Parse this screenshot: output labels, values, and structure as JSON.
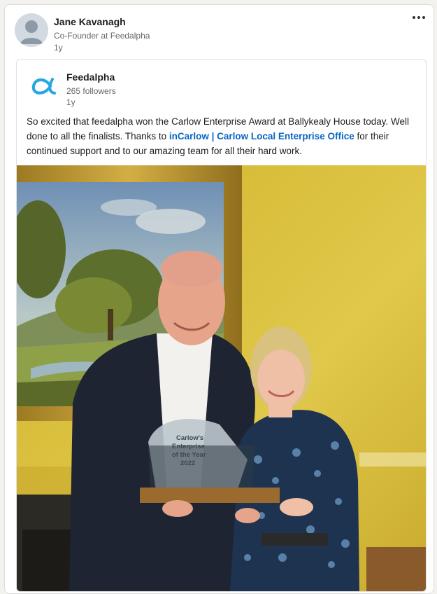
{
  "author": {
    "name": "Jane Kavanagh",
    "headline": "Co-Founder at Feedalpha",
    "time": "1y",
    "more_icon": "more-horizontal-icon"
  },
  "shared_post": {
    "org_name": "Feedalpha",
    "followers": "265 followers",
    "time": "1y",
    "logo_glyph": "α",
    "text_before": "So excited that feedalpha won the Carlow Enterprise Award at Ballykealy House today. Well done to all the finalists. Thanks to ",
    "mention": "inCarlow | Carlow Local Enterprise Office",
    "text_after": "  for their continued support and to our amazing team for all their hard work."
  },
  "photo": {
    "trophy_line1": "Carlow's",
    "trophy_line2": "Enterprise",
    "trophy_line3": "of the Year",
    "trophy_line4": "2022"
  },
  "colors": {
    "link": "#0a66c2",
    "logo": "#28a8e0",
    "wall": "#d9c13c"
  }
}
